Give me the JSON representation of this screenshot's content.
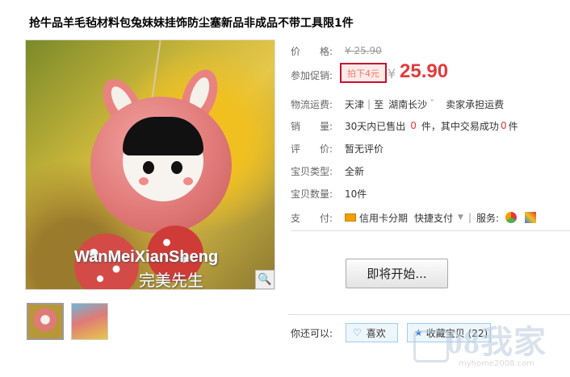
{
  "title": "抢牛品羊毛毡材料包兔妹妹挂饰防尘塞新品非成品不带工具限1件",
  "image": {
    "watermark_en": "WanMeiXianSheng",
    "watermark_cn": "完美先生",
    "zoom_icon": "magnifier-icon"
  },
  "thumbnails": [
    "thumb-1",
    "thumb-2"
  ],
  "price": {
    "label": "价　　格:",
    "original": "¥ 25.90"
  },
  "promo": {
    "label": "参加促销:",
    "badge": "拍下4元",
    "currency": "¥",
    "price": "25.90"
  },
  "shipping": {
    "label": "物流运费:",
    "from": "天津",
    "separator": "|",
    "to_prefix": "至",
    "to": "湖南长沙",
    "arrow": "ˇ",
    "note": "卖家承担运费"
  },
  "sales": {
    "label": "销　　量:",
    "text1": "30天内已售出",
    "count1": "0",
    "text2": "件，其中交易成功",
    "count2": "0",
    "text3": "件"
  },
  "rating": {
    "label": "评　　价:",
    "value": "暂无评价"
  },
  "item_type": {
    "label": "宝贝类型:",
    "value": "全新"
  },
  "quantity": {
    "label": "宝贝数量:",
    "value": "10件"
  },
  "payment": {
    "label": "支　　付:",
    "method1": "信用卡分期",
    "method2": "快捷支付",
    "services_label": "服务:"
  },
  "start_button": "即将开始...",
  "actions": {
    "label": "你还可以:",
    "like": "喜欢",
    "favorite": "收藏宝贝 (22)"
  },
  "site_logo": {
    "text": "08我家",
    "url": "myhome2008.com"
  }
}
